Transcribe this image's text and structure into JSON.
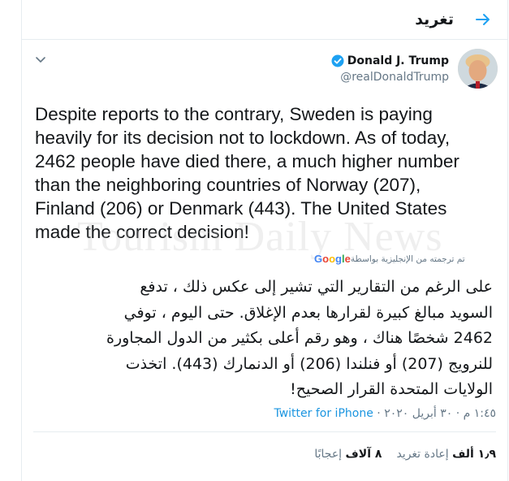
{
  "header": {
    "title": "تغريد",
    "back_icon": "arrow-left-icon",
    "accent_color": "#1da1f2"
  },
  "author": {
    "name": "Donald J. Trump",
    "handle": "@realDonaldTrump",
    "verified_icon": "verified-badge-icon"
  },
  "tweet": {
    "text": "Despite reports to the contrary, Sweden is paying\nheavily for its decision not to lockdown. As of today,\n2462 people have died there, a much higher number\nthan the neighboring countries of Norway (207),\nFinland (206) or Denmark (443). The United States\nmade the correct decision!"
  },
  "watermark": "Tourism Daily News",
  "translation": {
    "attribution": "تم ترجمته من الإنجليزية بواسطة",
    "provider": "Google",
    "text": "على الرغم من التقارير التي تشير إلى عكس ذلك ، تدفع\nالسويد مبالغ كبيرة لقرارها بعدم الإغلاق. حتى اليوم ، توفي\n2462 شخصًا هناك ، وهو رقم أعلى بكثير من الدول المجاورة\nللنرويج (207) أو فنلندا (206) أو الدنمارك (443). اتخذت\nالولايات المتحدة القرار الصحيح!"
  },
  "meta": {
    "time": "١:٤٥ م",
    "separator": "·",
    "date": "٣٠ أبريل ٢٠٢٠",
    "source": "Twitter for iPhone"
  },
  "stats": {
    "retweets_count": "١٫٩ ألف",
    "retweets_label": "إعادة تغريد",
    "likes_count": "٨ آلاف",
    "likes_label": "إعجابًا"
  }
}
